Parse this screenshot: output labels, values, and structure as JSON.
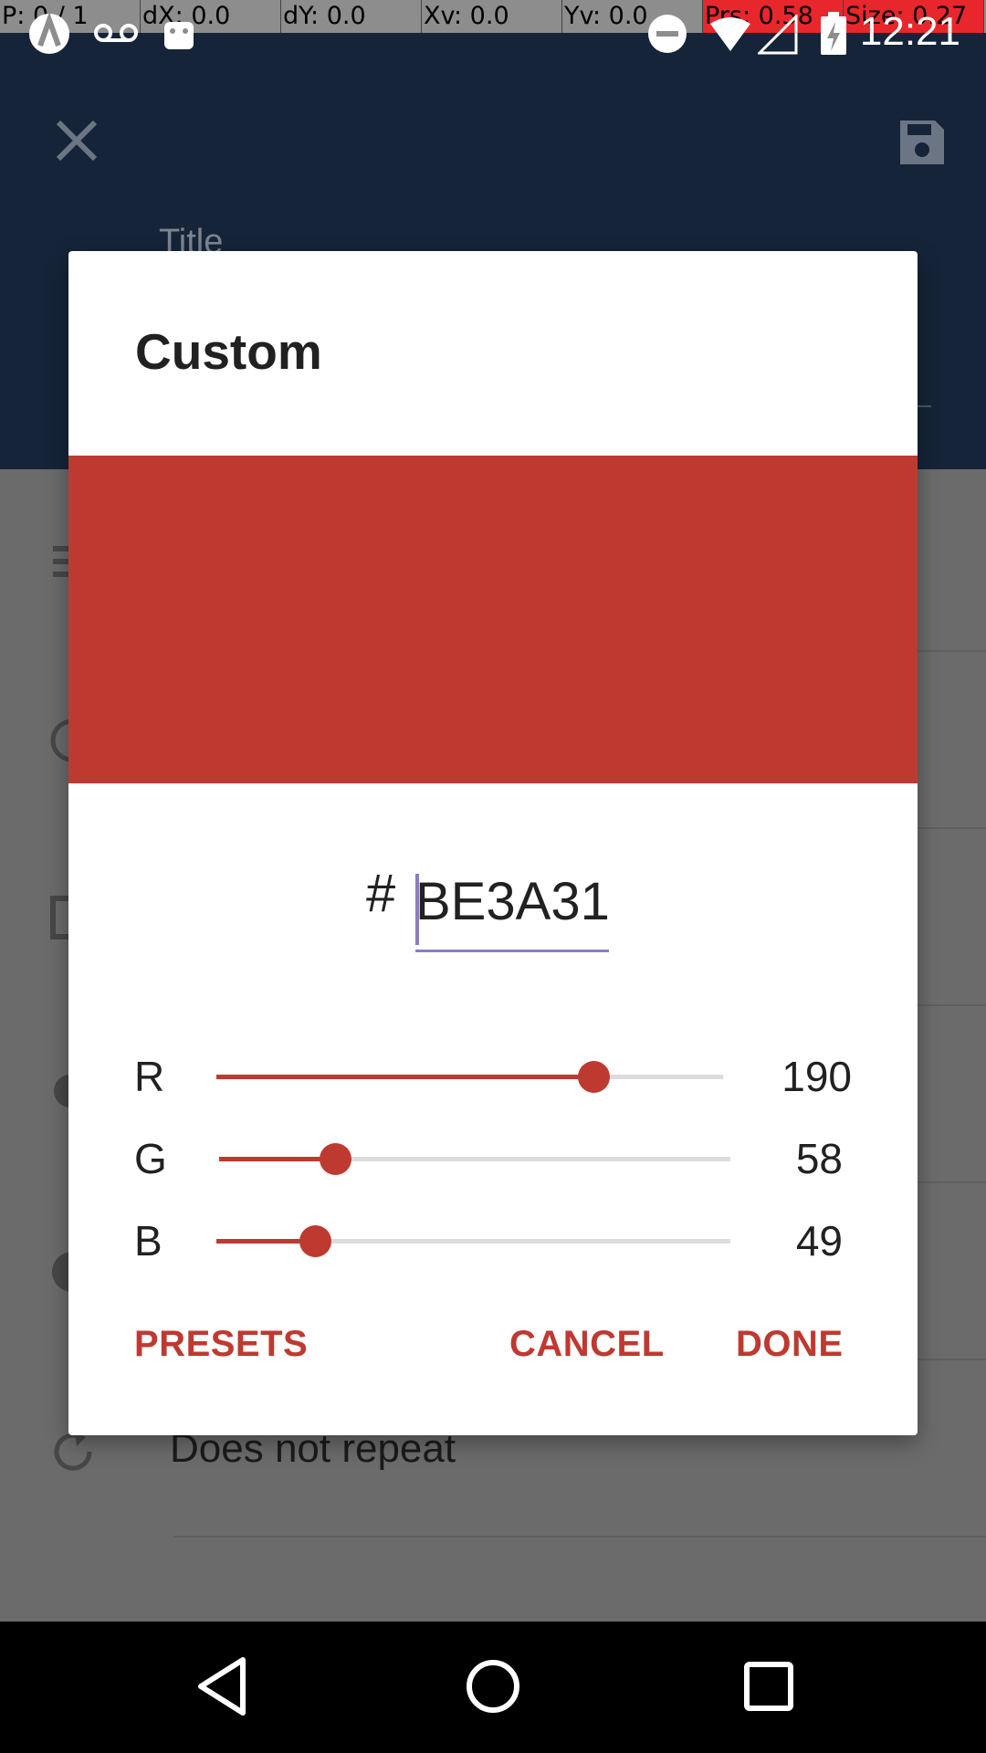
{
  "debug": {
    "pointer": "P: 0 / 1",
    "dx": "dX: 0.0",
    "dy": "dY: 0.0",
    "xv": "Xv: 0.0",
    "yv": "Yv: 0.0",
    "prs": "Prs: 0.58",
    "size": "Size: 0.27"
  },
  "status_bar": {
    "time": "12:21",
    "icons": [
      "app-icon",
      "voicemail-icon",
      "android-icon",
      "do-not-disturb-icon",
      "wifi-icon",
      "signal-icon",
      "battery-charging-icon"
    ]
  },
  "background": {
    "title_placeholder": "Title",
    "repeat_text": "Does not repeat",
    "header_color": "#152439"
  },
  "dialog": {
    "title": "Custom",
    "hex_prefix": "#",
    "hex_value": "BE3A31",
    "preview_color": "#BE3A31",
    "accent_color": "#BE3A31",
    "sliders": [
      {
        "label": "R",
        "value": "190",
        "fraction": 0.745
      },
      {
        "label": "G",
        "value": "58",
        "fraction": 0.227
      },
      {
        "label": "B",
        "value": "49",
        "fraction": 0.192
      }
    ],
    "buttons": {
      "presets": "PRESETS",
      "cancel": "CANCEL",
      "done": "DONE"
    }
  },
  "nav": {
    "icons": [
      "back-icon",
      "home-icon",
      "recents-icon"
    ]
  }
}
